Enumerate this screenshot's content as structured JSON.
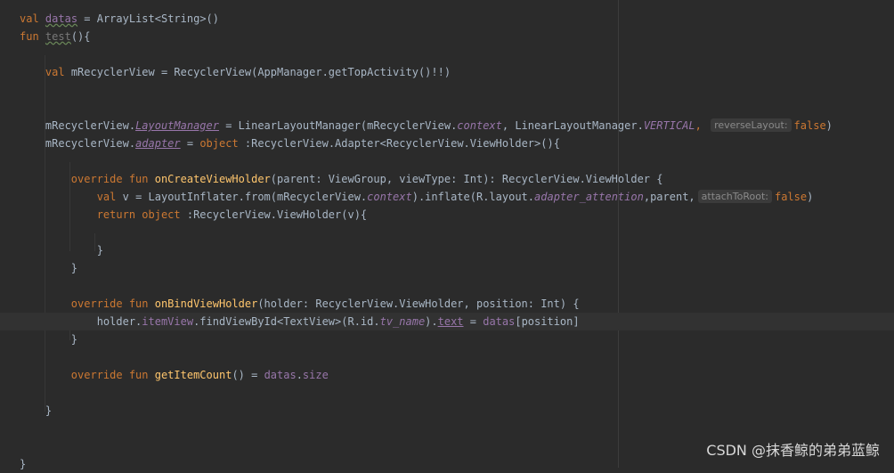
{
  "editor": {
    "lines": {
      "l01": {
        "kw_val": "val",
        "var_datas": "datas",
        "rest": " = ArrayList<String>()"
      },
      "l02": {
        "kw_fun": "fun",
        "fn_test": "test",
        "rest": "(){"
      },
      "l04": {
        "kw_val": "val",
        "rest": " mRecyclerView = RecyclerView(AppManager.getTopActivity()!!)"
      },
      "l07": {
        "recv": "mRecyclerView.",
        "prop_layout_manager": "LayoutManager",
        "mid": " = LinearLayoutManager(mRecyclerView.",
        "prop_context": "context",
        "mid2": ", LinearLayoutManager.",
        "prop_vertical": "VERTICAL",
        "comma": ",",
        "hint_reverse": "reverseLayout:",
        "kw_false": "false",
        "close": ")"
      },
      "l08": {
        "recv": "mRecyclerView.",
        "prop_adapter": "adapter",
        "eq": " = ",
        "kw_object": "object",
        "rest": " :RecyclerView.Adapter<RecyclerView.ViewHolder>(){"
      },
      "l10": {
        "kw_override_fun": "override fun",
        "fn_name": "onCreateViewHolder",
        "rest": "(parent: ViewGroup, viewType: Int): RecyclerView.ViewHolder {"
      },
      "l11": {
        "kw_val": "val",
        "mid": " v = LayoutInflater.from(mRecyclerView.",
        "prop_context": "context",
        "mid2": ").inflate(R.layout.",
        "prop_layout": "adapter_attention",
        "mid3": ",parent,",
        "hint_attach": "attachToRoot:",
        "kw_false": "false",
        "close": ")"
      },
      "l12": {
        "kw_return_object": "return object",
        "rest": " :RecyclerView.ViewHolder(v){"
      },
      "l14": {
        "text": "}"
      },
      "l15": {
        "text": "}"
      },
      "l17": {
        "kw_override_fun": "override fun",
        "fn_name": "onBindViewHolder",
        "rest": "(holder: RecyclerView.ViewHolder, position: Int) {"
      },
      "l18": {
        "holder": "holder.",
        "prop_item_view": "itemView",
        "mid": ".findViewById<TextView>(R.id.",
        "prop_tv_name": "tv_name",
        "mid2": ").",
        "prop_text": "text",
        "eq": " = ",
        "prop_datas": "datas",
        "close": "[position]"
      },
      "l19": {
        "text": "}"
      },
      "l21": {
        "kw_override_fun": "override fun",
        "fn_name": "getItemCount",
        "eq": "() = ",
        "prop_datas": "datas",
        "dot": ".",
        "prop_size": "size"
      },
      "l23": {
        "text": "}"
      },
      "l26": {
        "text": "}"
      }
    }
  },
  "watermark": {
    "text": "CSDN @抹香鲸的弟弟蓝鲸"
  },
  "colors": {
    "background": "#2b2b2b",
    "keyword": "#cc7832",
    "function": "#ffc66d",
    "property": "#9876aa",
    "text": "#a9b7c6"
  }
}
